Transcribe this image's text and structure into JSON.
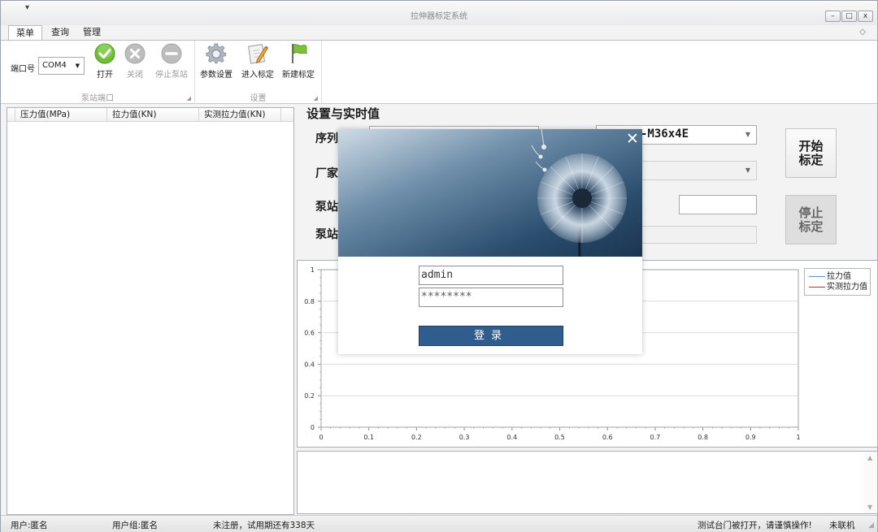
{
  "window": {
    "title": "拉伸器标定系统",
    "qat_symbol": "▾",
    "controls": {
      "minimize": "–",
      "maximize": "□",
      "close": "x"
    }
  },
  "menu_tabs": [
    {
      "label": "菜单",
      "active": true
    },
    {
      "label": "查询",
      "active": false
    },
    {
      "label": "管理",
      "active": false
    }
  ],
  "ribbon": {
    "collapse_symbol": "◇",
    "pump_group": {
      "name": "泵站端口",
      "port_label": "端口号",
      "port_value": "COM4",
      "open_label": "打开",
      "close_label": "关闭",
      "stop_label": "停止泵站"
    },
    "settings_group": {
      "name": "设置",
      "params_label": "参数设置",
      "enter_label": "进入标定",
      "new_label": "新建标定"
    }
  },
  "table": {
    "columns": [
      "压力值(MPa)",
      "拉力值(KN)",
      "实测拉力值(KN)"
    ],
    "rows": []
  },
  "settings_panel": {
    "title": "设置与实时值",
    "serial_label": "序列",
    "vendor_label": "厂家",
    "pump_label_1": "泵站",
    "pump_label_2": "泵站",
    "model_value": "-M36x4E",
    "start_button": "开始标定",
    "stop_button": "停止标定"
  },
  "chart_data": {
    "type": "line",
    "title": "",
    "xlabel": "",
    "ylabel": "",
    "xlim": [
      0,
      1
    ],
    "ylim": [
      0,
      1
    ],
    "x_ticks": [
      "0",
      "0.1",
      "0.2",
      "0.3",
      "0.4",
      "0.5",
      "0.6",
      "0.7",
      "0.8",
      "0.9",
      "1"
    ],
    "y_ticks": [
      "0",
      "0.2",
      "0.4",
      "0.6",
      "0.8",
      "1"
    ],
    "grid": "horizontal",
    "legend_position": "top-right",
    "series": [
      {
        "name": "拉力值",
        "color": "#5b8fd6",
        "values": []
      },
      {
        "name": "实测拉力值",
        "color": "#b23a3a",
        "values": []
      }
    ]
  },
  "login_dialog": {
    "close_symbol": "✕",
    "username": "admin",
    "password_masked": "********",
    "login_button": "登录"
  },
  "statusbar": {
    "user": "用户:匿名",
    "group": "用户组:匿名",
    "trial": "未注册，试用期还有338天",
    "warning": "测试台门被打开，请谨慎操作!",
    "connection": "未联机"
  }
}
